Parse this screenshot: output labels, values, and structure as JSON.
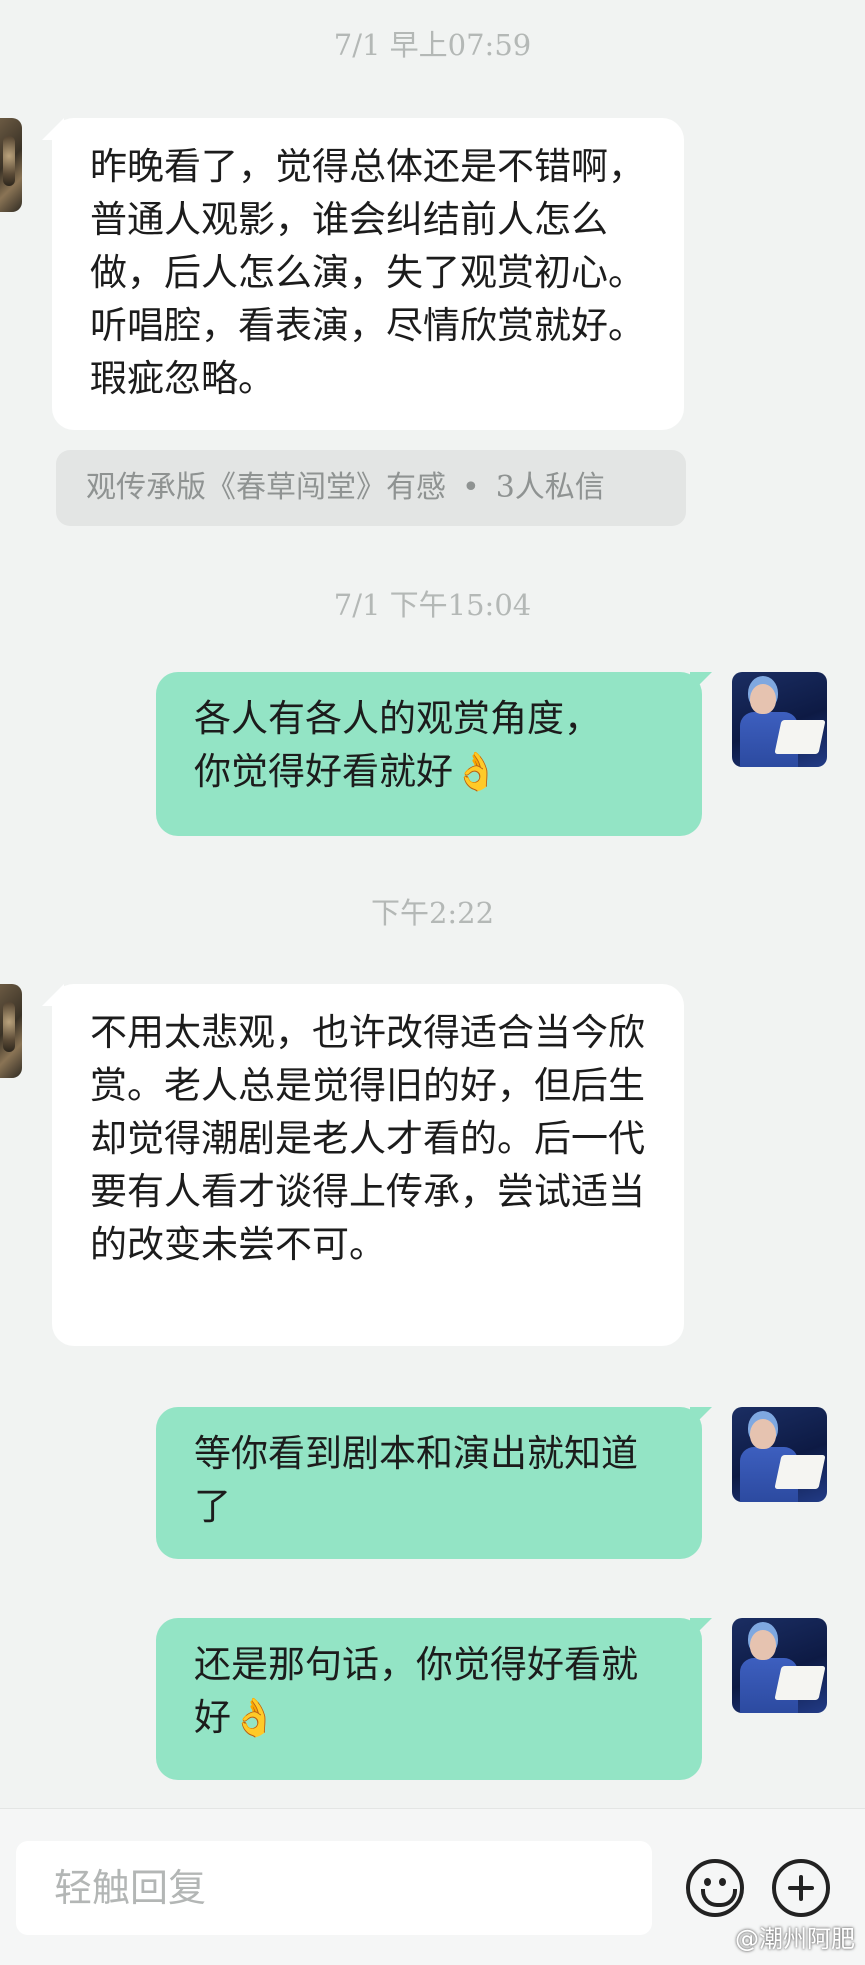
{
  "messages": {
    "ts1": "7/1 早上07:59",
    "msg1": "昨晚看了，觉得总体还是不错啊，普通人观影，谁会纠结前人怎么做，后人怎么演，失了观赏初心。听唱腔，看表演，尽情欣赏就好。瑕疵忽略。",
    "topic": {
      "text": "观传承版《春草闯堂》有感",
      "dot": "•",
      "count": "3人私信"
    },
    "ts2": "7/1 下午15:04",
    "msg2": "各人有各人的观赏角度，\n你觉得好看就好👌",
    "ts3": "下午2:22",
    "msg3": "不用太悲观，也许改得适合当今欣赏。老人总是觉得旧的好，但后生却觉得潮剧是老人才看的。后一代要有人看才谈得上传承，尝试适当的改变未尝不可。",
    "msg4": "等你看到剧本和演出就知道了",
    "msg5": "还是那句话，你觉得好看就好👌"
  },
  "composer": {
    "placeholder": "轻触回复"
  },
  "icons": {
    "emoji": "emoji-icon",
    "add": "plus-icon"
  },
  "watermark": "@潮州阿肥",
  "colors": {
    "background": "#f1f3f2",
    "incoming_bubble": "#ffffff",
    "outgoing_bubble": "#93e4c5",
    "timestamp": "#b4b8b6"
  }
}
